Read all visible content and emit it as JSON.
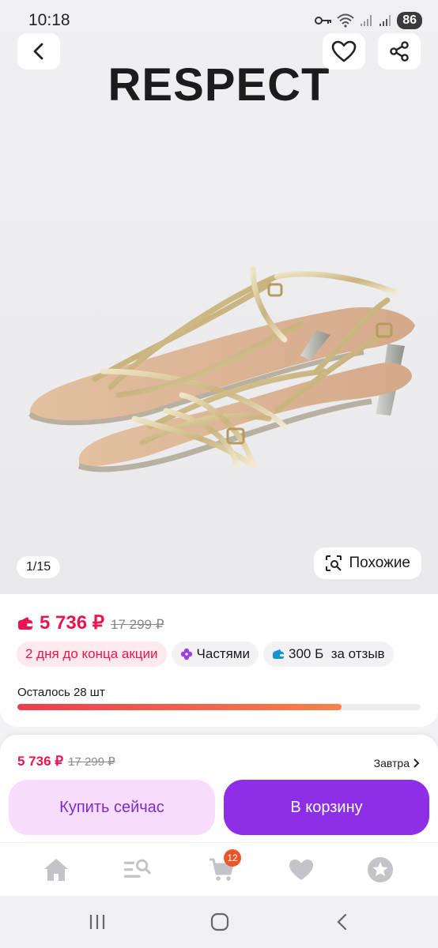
{
  "status_bar": {
    "time": "10:18",
    "battery": "86"
  },
  "hero": {
    "brand": "RESPECT",
    "pager": "1/15",
    "similar_label": "Похожие",
    "icons": {
      "back": "chevron-left-icon",
      "favorite": "heart-icon",
      "share": "share-icon"
    }
  },
  "pricing": {
    "price": "5 736 ₽",
    "old_price": "17 299 ₽",
    "badges": [
      {
        "label": "2 дня до конца акции",
        "color": "#e8164e"
      },
      {
        "label": "Частями",
        "icon": "flower-icon"
      },
      {
        "label": "300 Б  за отзыв",
        "icon": "wallet-icon"
      }
    ],
    "stock_label": "Осталось 28 шт",
    "stock_fill_fraction": 0.804
  },
  "buy_panel": {
    "price": "5 736 ₽",
    "old_price": "17 299 ₽",
    "delivery": "Завтра",
    "buy_now_label": "Купить сейчас",
    "add_to_cart_label": "В корзину"
  },
  "bottom_nav": {
    "items": [
      "home-icon",
      "catalog-search-icon",
      "cart-icon",
      "favorites-icon",
      "profile-icon"
    ],
    "cart_count": "12"
  },
  "colors": {
    "accent": "#8e2fe8",
    "price": "#e8164e",
    "buy_now_bg": "#f8dcfc"
  }
}
